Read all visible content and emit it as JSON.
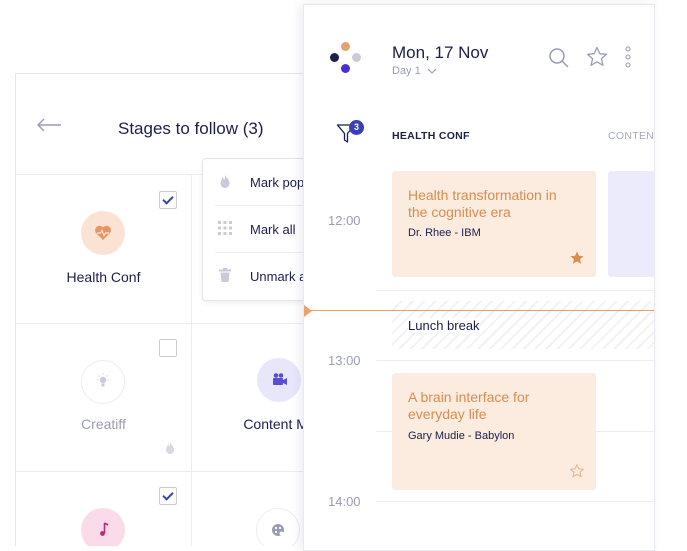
{
  "stages_panel": {
    "title": "Stages to follow (3)",
    "stages": [
      {
        "name": "Health Conf",
        "checked": true,
        "icon": "heart-icon",
        "color": "#fbe3d4",
        "icon_color": "#e9956a"
      },
      {
        "name": "Creatiff",
        "checked": false,
        "icon": "lightbulb-icon",
        "color": "#ffffff",
        "icon_color": "#c9cbd8"
      },
      {
        "name": "Content Ma",
        "checked": false,
        "icon": "video-camera-icon",
        "color": "#e8e6fb",
        "icon_color": "#5a4fd4"
      },
      {
        "name": "",
        "checked": true,
        "icon": "music-note-icon",
        "color": "#fbdbe9",
        "icon_color": "#c2257a"
      },
      {
        "name": "",
        "checked": false,
        "icon": "palette-icon",
        "color": "#ffffff",
        "icon_color": "#9a9cb4"
      }
    ],
    "menu": [
      {
        "label": "Mark pop",
        "icon": "flame-icon"
      },
      {
        "label": "Mark all",
        "icon": "grid-icon"
      },
      {
        "label": "Unmark a",
        "icon": "trash-icon"
      }
    ]
  },
  "schedule": {
    "date": "Mon, 17 Nov",
    "day": "Day 1",
    "filter_count": "3",
    "columns": [
      "HEALTH CONF",
      "CONTEN"
    ],
    "times": [
      "12:00",
      "13:00",
      "14:00"
    ],
    "sessions": [
      {
        "title": "Health transformation in the cognitive era",
        "speaker": "Dr. Rhee - IBM",
        "starred": true
      },
      {
        "title": "A brain interface for everyday life",
        "speaker": "Gary Mudie - Babylon",
        "starred": false
      }
    ],
    "break_label": "Lunch break"
  },
  "colors": {
    "accent": "#3b3fb6",
    "session_bg": "#fcebdf",
    "session_text": "#d98d4f",
    "now_line": "#e9a26a"
  }
}
